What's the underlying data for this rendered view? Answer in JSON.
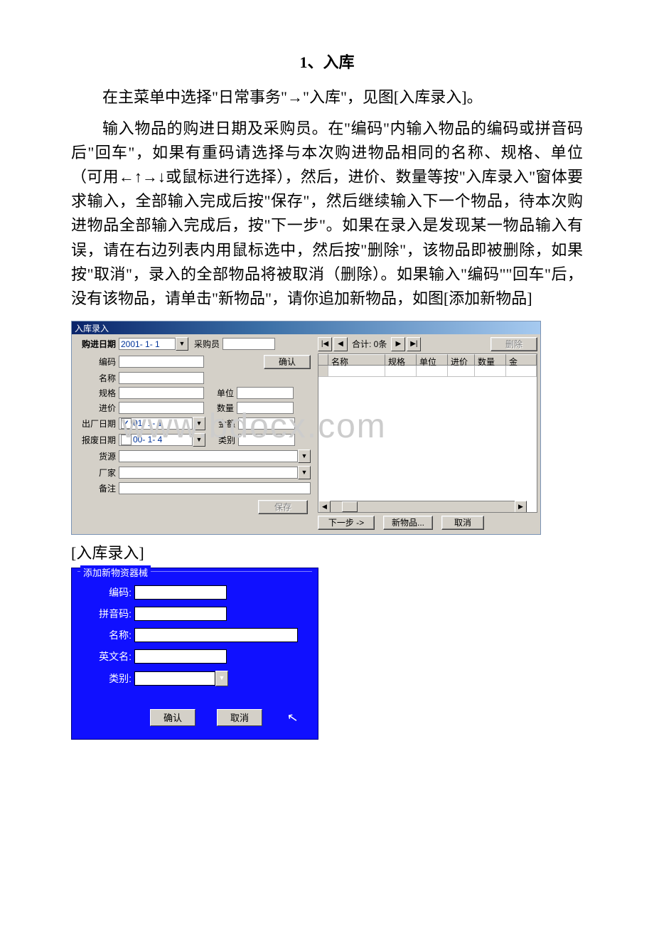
{
  "doc": {
    "heading": "1、入库",
    "p1": "在主菜单中选择\"日常事务\"→\"入库\"，见图[入库录入]。",
    "p2": "输入物品的购进日期及采购员。在\"编码\"内输入物品的编码或拼音码后\"回车\"，如果有重码请选择与本次购进物品相同的名称、规格、单位（可用←↑→↓或鼠标进行选择），然后，进价、数量等按\"入库录入\"窗体要求输入，全部输入完成后按\"保存\"，然后继续输入下一个物品，待本次购进物品全部输入完成后，按\"下一步\"。如果在录入是发现某一物品输入有误，请在右边列表内用鼠标选中，然后按\"删除\"，该物品即被删除，如果按\"取消\"，录入的全部物品将被取消（删除）。如果输入\"编码\"\"回车\"后，没有该物品，请单击\"新物品\"，请你追加新物品，如图[添加新物品]",
    "caption1": "[入库录入]",
    "watermark": "www.bdocx.com"
  },
  "app1": {
    "title": "入库录入",
    "labels": {
      "purchase_date": "购进日期",
      "buyer": "采购员",
      "code": "编码",
      "name": "名称",
      "spec": "规格",
      "unit": "单位",
      "price": "进价",
      "qty": "数量",
      "mfg_date": "出厂日期",
      "amount": "金额",
      "scrap_date": "报废日期",
      "category": "类别",
      "source": "货源",
      "maker": "厂家",
      "remark": "备注"
    },
    "values": {
      "purchase_date": "2001- 1- 1",
      "mfg_date": "01- 1- 1",
      "scrap_date": "00- 1- 4"
    },
    "buttons": {
      "confirm": "确认",
      "save": "保存",
      "delete": "删除",
      "next": "下一步 ->",
      "new_item": "新物品...",
      "cancel": "取消"
    },
    "grid": {
      "total_prefix": "合计: ",
      "total_count": "0条",
      "columns": [
        "",
        "名称",
        "规格",
        "单位",
        "进价",
        "数量",
        "金"
      ]
    }
  },
  "app2": {
    "group_title": "添加新物资器械",
    "labels": {
      "code": "编码:",
      "pinyin": "拼音码:",
      "name": "名称:",
      "english": "英文名:",
      "category": "类别:"
    },
    "buttons": {
      "ok": "确认",
      "cancel": "取消"
    }
  }
}
